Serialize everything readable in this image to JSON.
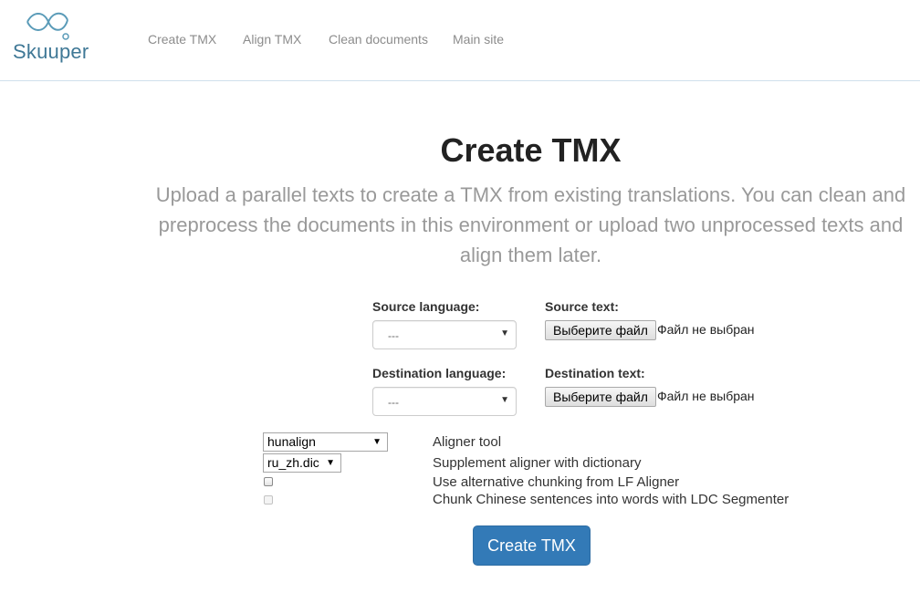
{
  "brand": {
    "name": "Skuuper",
    "logo_icon": "wave-loop-icon"
  },
  "nav": {
    "items": [
      {
        "label": "Create TMX"
      },
      {
        "label": "Align TMX"
      },
      {
        "label": "Clean documents"
      },
      {
        "label": "Main site"
      }
    ]
  },
  "page": {
    "title": "Create TMX",
    "lead": "Upload a parallel texts to create a TMX from existing translations. You can clean and preprocess the documents in this environment or upload two unprocessed texts and align them later."
  },
  "form": {
    "source_language": {
      "label": "Source language:",
      "value": "---"
    },
    "destination_language": {
      "label": "Destination language:",
      "value": "---"
    },
    "source_text": {
      "label": "Source text:",
      "button": "Выберите файл",
      "status": "Файл не выбран"
    },
    "destination_text": {
      "label": "Destination text:",
      "button": "Выберите файл",
      "status": "Файл не выбран"
    },
    "aligner_tool": {
      "value": "hunalign",
      "label": "Aligner tool"
    },
    "dictionary": {
      "value": "ru_zh.dic",
      "label": "Supplement aligner with dictionary"
    },
    "lf_chunking": {
      "label": "Use alternative chunking from LF Aligner",
      "checked": false
    },
    "ldc_segmenter": {
      "label": "Chunk Chinese sentences into words with LDC Segmenter",
      "checked": false,
      "disabled": true
    },
    "submit_label": "Create TMX"
  },
  "colors": {
    "primary": "#337ab7",
    "brand": "#3f7896",
    "nav_text": "#8c8c8c",
    "lead_text": "#999999"
  }
}
